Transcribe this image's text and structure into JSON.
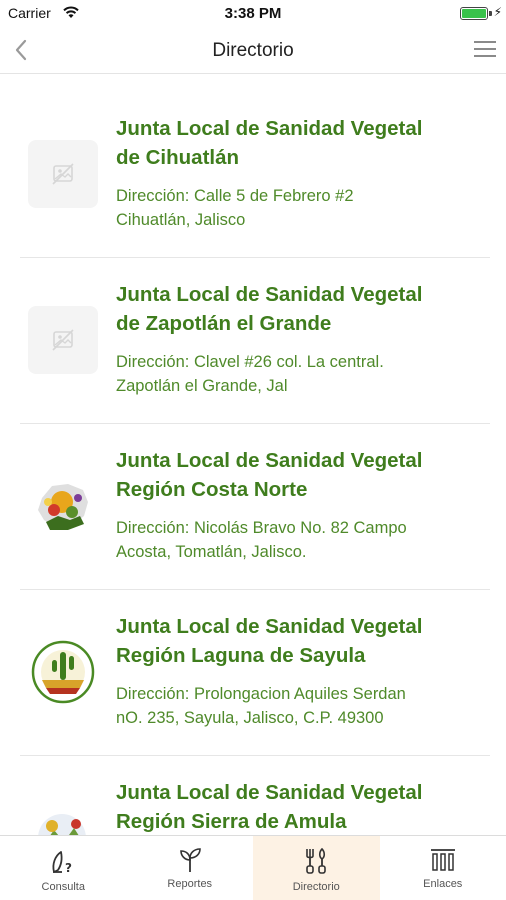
{
  "status_bar": {
    "carrier": "Carrier",
    "time": "3:38 PM",
    "battery_level": 1.0
  },
  "nav": {
    "title": "Directorio"
  },
  "entries": [
    {
      "name_line1": "Junta Local de Sanidad Vegetal",
      "name_line2": "de Cihuatlán",
      "address_line1": "Dirección: Calle 5 de Febrero #2",
      "address_line2": "Cihuatlán, Jalisco",
      "image": "placeholder-image-icon"
    },
    {
      "name_line1": "Junta Local de Sanidad Vegetal",
      "name_line2": "de Zapotlán el Grande",
      "address_line1": "Dirección: Clavel #26 col. La central.",
      "address_line2": "Zapotlán el Grande, Jal",
      "image": "placeholder-image-icon"
    },
    {
      "name_line1": "Junta Local de Sanidad Vegetal",
      "name_line2": "Región Costa Norte",
      "address_line1": "Dirección: Nicolás Bravo No. 82 Campo",
      "address_line2": "Acosta, Tomatlán, Jalisco.",
      "image": "costa-norte-logo"
    },
    {
      "name_line1": "Junta Local de Sanidad Vegetal",
      "name_line2": "Región Laguna de Sayula",
      "address_line1": "Dirección: Prolongacion Aquiles Serdan",
      "address_line2": "nO. 235, Sayula, Jalisco, C.P. 49300",
      "image": "laguna-de-sayula-logo"
    },
    {
      "name_line1": "Junta Local de Sanidad Vegetal",
      "name_line2": "Región Sierra de Amula",
      "address_line1": "",
      "address_line2": "",
      "image": "sierra-de-amula-logo"
    }
  ],
  "tabs": [
    {
      "label": "Consulta",
      "icon": "consulta-icon",
      "active": false
    },
    {
      "label": "Reportes",
      "icon": "sprout-icon",
      "active": false
    },
    {
      "label": "Directorio",
      "icon": "tools-icon",
      "active": true
    },
    {
      "label": "Enlaces",
      "icon": "columns-icon",
      "active": false
    }
  ],
  "colors": {
    "title_green": "#3f7d1d",
    "address_green": "#4f8a2a",
    "active_tab_bg": "#fdf2e4",
    "battery_green": "#38c24a"
  }
}
